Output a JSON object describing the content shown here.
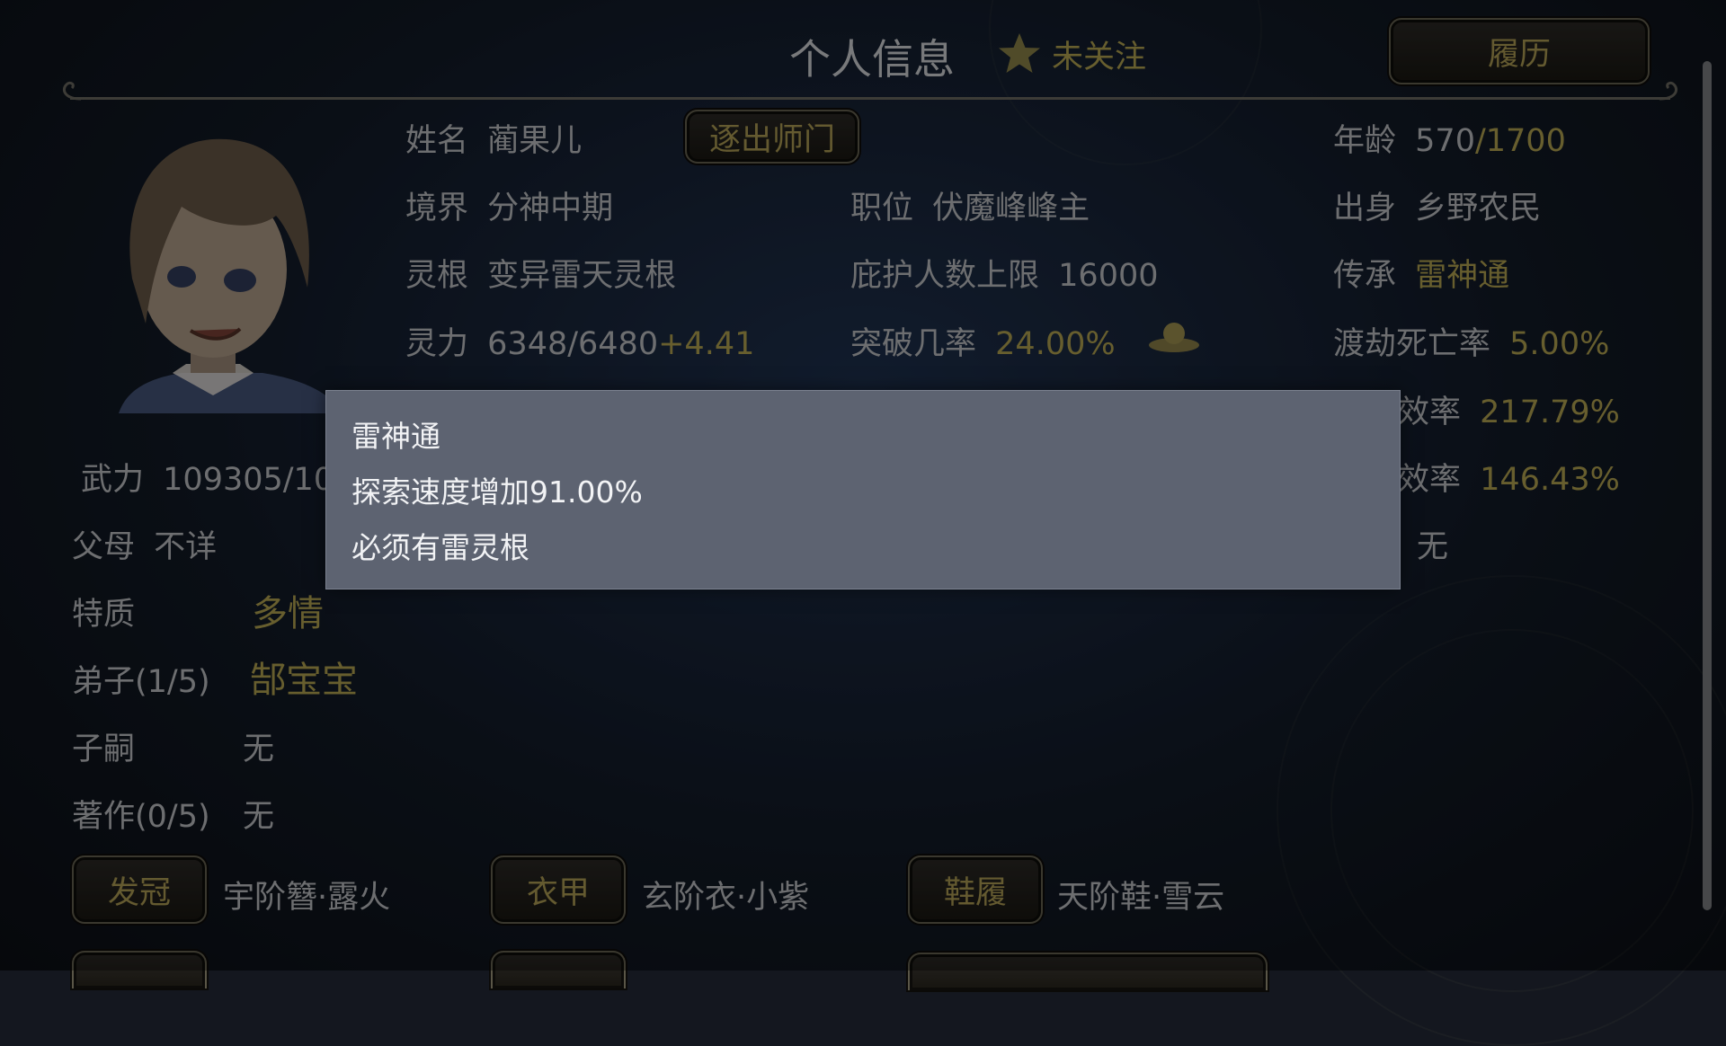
{
  "header": {
    "title": "个人信息",
    "follow_label": "未关注",
    "history_button": "履历"
  },
  "info": {
    "name_label": "姓名",
    "name_value": "蔺果儿",
    "expel_button": "逐出师门",
    "age_label": "年龄",
    "age_current": "570",
    "age_max": "/1700",
    "realm_label": "境界",
    "realm_value": "分神中期",
    "position_label": "职位",
    "position_value": "伏魔峰峰主",
    "origin_label": "出身",
    "origin_value": "乡野农民",
    "root_label": "灵根",
    "root_value": "变异雷天灵根",
    "protect_label": "庇护人数上限",
    "protect_value": "16000",
    "inherit_label": "传承",
    "inherit_value": "雷神通",
    "spirit_label": "灵力",
    "spirit_value": "6348/6480",
    "spirit_regen": "+4.41",
    "breakthrough_label": "突破几率",
    "breakthrough_value": "24.00%",
    "tribulation_label": "渡劫死亡率",
    "tribulation_value": "5.00%",
    "efficiency1_label": "效率",
    "efficiency1_value": "217.79%",
    "efficiency2_label": "效率",
    "efficiency2_value": "146.43%",
    "force_label": "武力",
    "force_value": "109305/109",
    "parents_label": "父母",
    "parents_value": "不详",
    "right_row8_value": "无",
    "trait_label": "特质",
    "trait_value": "多情",
    "disciples_label": "弟子(1/5)",
    "disciples_value": "郜宝宝",
    "heirs_label": "子嗣",
    "heirs_value": "无",
    "works_label": "著作(0/5)",
    "works_value": "无"
  },
  "equipment": [
    {
      "slot": "发冠",
      "item": "宇阶簪·露火"
    },
    {
      "slot": "衣甲",
      "item": "玄阶衣·小紫"
    },
    {
      "slot": "鞋履",
      "item": "天阶鞋·雪云"
    }
  ],
  "tooltip": {
    "title": "雷神通",
    "line1": "探索速度增加91.00%",
    "line2": "必须有雷灵根"
  },
  "colors": {
    "gold": "#9f9148",
    "text": "#a8aaad",
    "tooltip_bg": "#5d6371"
  },
  "icons": {
    "follow": "star-icon",
    "breakthrough": "lotus-icon",
    "portrait": "character-portrait"
  }
}
